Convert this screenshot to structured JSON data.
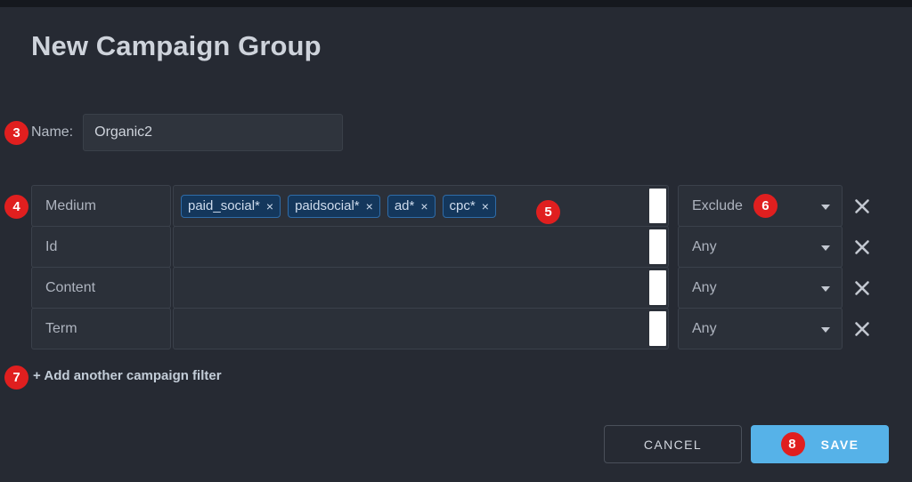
{
  "dialog": {
    "title": "New Campaign Group"
  },
  "name_field": {
    "label": "Name:",
    "value": "Organic2",
    "placeholder": ""
  },
  "filters": {
    "rows": [
      {
        "label": "Medium",
        "tags": [
          {
            "text": "paid_social*",
            "remove": "×"
          },
          {
            "text": "paidsocial*",
            "remove": "×"
          },
          {
            "text": "ad*",
            "remove": "×"
          },
          {
            "text": "cpc*",
            "remove": "×"
          }
        ],
        "mode": "Exclude",
        "remove_icon": "close-icon"
      },
      {
        "label": "Id",
        "tags": [],
        "mode": "Any",
        "remove_icon": "close-icon"
      },
      {
        "label": "Content",
        "tags": [],
        "mode": "Any",
        "remove_icon": "close-icon"
      },
      {
        "label": "Term",
        "tags": [],
        "mode": "Any",
        "remove_icon": "close-icon"
      }
    ]
  },
  "add_filter_link": "+ Add another campaign filter",
  "footer": {
    "cancel_label": "CANCEL",
    "save_label": "SAVE"
  },
  "badges": {
    "b3": "3",
    "b4": "4",
    "b5": "5",
    "b6": "6",
    "b7": "7",
    "b8": "8"
  },
  "colors": {
    "background": "#262a33",
    "top_strip": "#15181e",
    "field_bg": "#2b3039",
    "field_border": "#3b414b",
    "tag_bg": "#14375c",
    "tag_border": "#2f6ca8",
    "badge_red": "#e01f1f",
    "save_blue": "#56b2e8",
    "text_primary": "#ced3db",
    "text_muted": "#aeb4bf",
    "scrollbar": "#ffffff"
  }
}
